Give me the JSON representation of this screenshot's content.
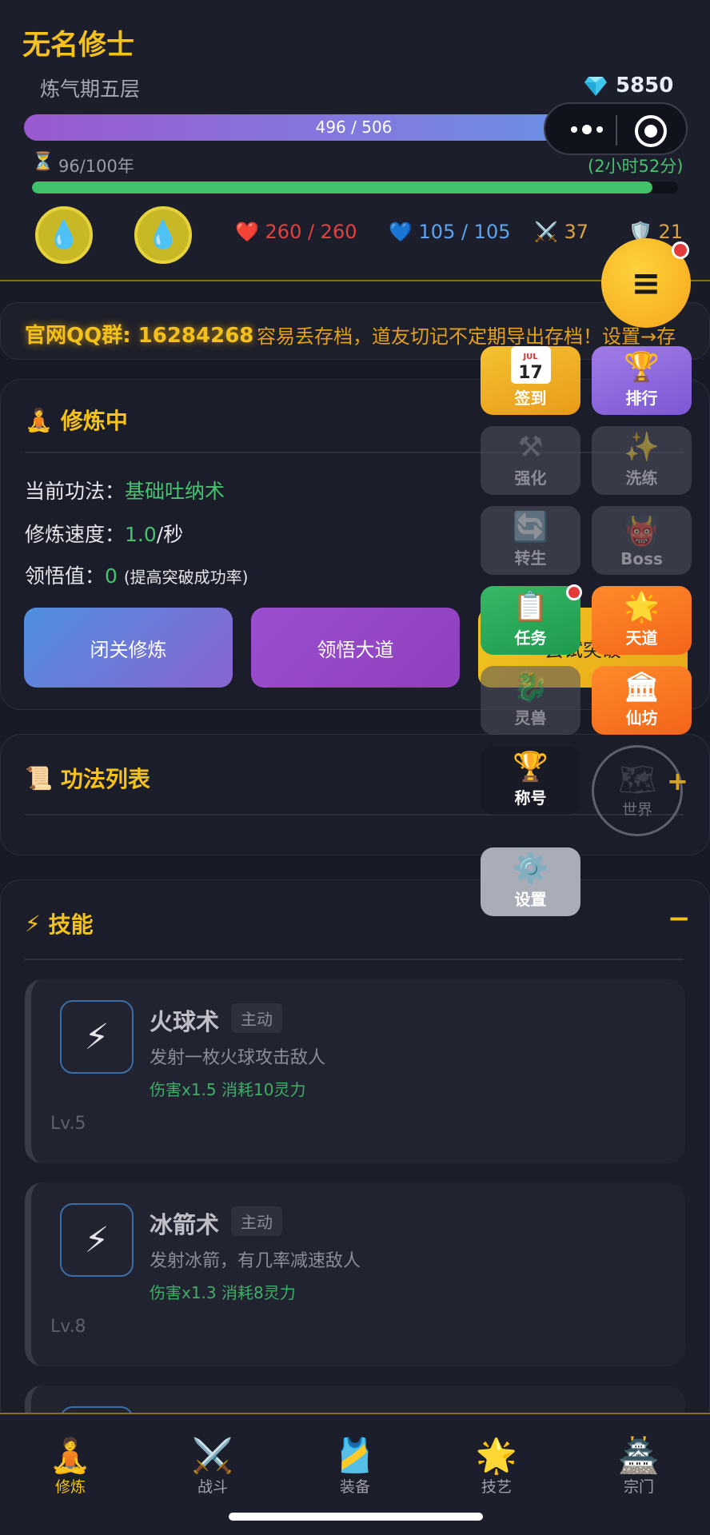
{
  "player": {
    "name": "无名修士",
    "realm": "炼气期五层",
    "gems": "5850",
    "exp_text": "496 / 506",
    "exp_fraction": 0.98,
    "lifespan": "96/100年",
    "lifespan_timer": "(2小时52分)",
    "lifespan_fraction": 0.96
  },
  "stats": {
    "hp": "260 / 260",
    "mp": "105 / 105",
    "atk": "37",
    "def": "21"
  },
  "ticker": {
    "qq": "官网QQ群: 16284268",
    "notice": "容易丢存档，道友切记不定期导出存档！设置→存"
  },
  "cultivation": {
    "title": "修炼中",
    "method_label": "当前功法：",
    "method_value": "基础吐纳术",
    "speed_label": "修炼速度：",
    "speed_value": "1.0",
    "speed_unit": "/秒",
    "insight_label": "领悟值：",
    "insight_value": "0",
    "insight_note": "(提高突破成功率)",
    "btn_seclusion": "闭关修炼",
    "btn_enlighten": "领悟大道",
    "btn_breakthrough": "尝试突破"
  },
  "methods": {
    "title": "功法列表"
  },
  "skills": {
    "title": "技能",
    "collapse": "−",
    "items": [
      {
        "name": "火球术",
        "tag": "主动",
        "desc": "发射一枚火球攻击敌人",
        "stats": "伤害x1.5 消耗10灵力",
        "level": "Lv.5"
      },
      {
        "name": "冰箭术",
        "tag": "主动",
        "desc": "发射冰箭，有几率减速敌人",
        "stats": "伤害x1.3 消耗8灵力",
        "level": "Lv.8"
      }
    ]
  },
  "menu": {
    "checkin": "签到",
    "checkin_month": "JUL",
    "checkin_day": "17",
    "rank": "排行",
    "enhance": "强化",
    "reforge": "洗练",
    "rebirth": "转生",
    "boss": "Boss",
    "quest": "任务",
    "dao": "天道",
    "beast": "灵兽",
    "shop": "仙坊",
    "title_btn": "称号",
    "world": "世界",
    "settings": "设置",
    "plus": "+"
  },
  "tabs": [
    {
      "label": "修炼",
      "icon": "meditation-icon"
    },
    {
      "label": "战斗",
      "icon": "crossed-swords-icon"
    },
    {
      "label": "装备",
      "icon": "vest-icon"
    },
    {
      "label": "技艺",
      "icon": "star-icon"
    },
    {
      "label": "宗门",
      "icon": "temple-icon"
    }
  ],
  "colors": {
    "accent": "#f5c21b",
    "green": "#47c26e",
    "hp": "#e0423f",
    "mp": "#5fa2ef"
  }
}
